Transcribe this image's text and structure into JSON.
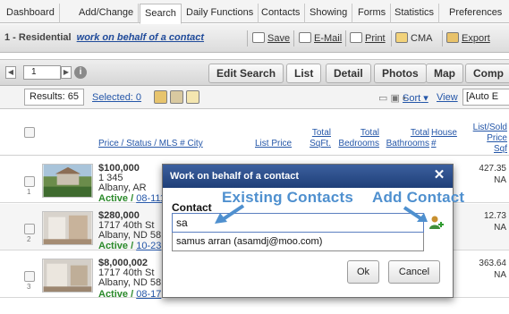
{
  "nav": {
    "tabs": [
      "Dashboard",
      "Add/Change",
      "Search",
      "Daily Functions",
      "Contacts",
      "Showing",
      "Forms",
      "Statistics",
      "Preferences"
    ],
    "active": "Search"
  },
  "toolbar": {
    "context_prefix": "1 - Residential",
    "context_link": "work on behalf of a contact",
    "save": "Save",
    "email": "E-Mail",
    "print": "Print",
    "cma": "CMA",
    "export": "Export"
  },
  "pager": {
    "page": "1"
  },
  "views": {
    "edit_search": "Edit Search",
    "list": "List",
    "detail": "Detail",
    "photos": "Photos",
    "map": "Map",
    "comp": "Comp"
  },
  "results": {
    "count_label": "Results: 65",
    "selected_label": "Selected: 0",
    "sort": "Sort",
    "view": "View",
    "auto": "[Auto E"
  },
  "headers": {
    "price_status_mls_city": "Price / Status / MLS # City",
    "list_price": "List Price",
    "total_sqft": [
      "Total",
      "SqFt."
    ],
    "total_bedrooms": [
      "Total",
      "Bedrooms"
    ],
    "total_bathrooms": [
      "Total",
      "Bathrooms"
    ],
    "house_num": [
      "House",
      "#"
    ],
    "list_sold_price_sqft": [
      "List/Sold",
      "Price",
      "Sqf"
    ]
  },
  "rows": [
    {
      "num": "1",
      "price": "$100,000",
      "addr1": "1 345",
      "addr2": "Albany, AR",
      "status": "Active",
      "date": "08-111",
      "right1": "427.35",
      "right2": "NA"
    },
    {
      "num": "2",
      "price": "$280,000",
      "addr1": "1717 40th St",
      "addr2": "Albany, ND 5816",
      "status": "Active",
      "date": "10-23",
      "right1": "12.73",
      "right2": "NA"
    },
    {
      "num": "3",
      "price": "$8,000,002",
      "addr1": "1717 40th St",
      "addr2": "Albany, ND 5816",
      "status": "Active",
      "date": "08-17",
      "right1": "363.64",
      "right2": "NA"
    }
  ],
  "modal": {
    "title": "Work on behalf of a contact",
    "contact_label": "Contact",
    "contact_value": "sa",
    "suggestion": "samus arran (asamdj@moo.com)",
    "ok": "Ok",
    "cancel": "Cancel"
  },
  "annotations": {
    "existing": "Existing Contacts",
    "add": "Add Contact"
  },
  "colors": {
    "accent_blue": "#2456a8",
    "modal_header": "#2a4d8c",
    "active_green": "#2b8a2b",
    "annotation": "#4f90cf"
  }
}
